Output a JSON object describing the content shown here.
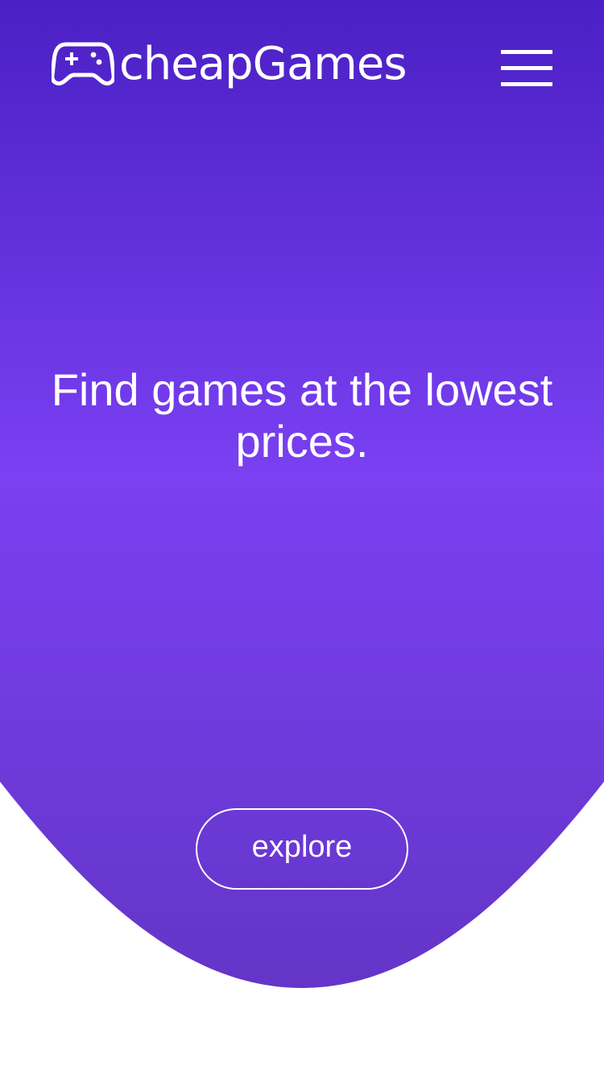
{
  "colors": {
    "gradient_top": "#4a20c4",
    "gradient_middle": "#7a40f2",
    "gradient_bottom": "#6435c7",
    "text": "#ffffff",
    "page_background": "#ffffff"
  },
  "header": {
    "logo_icon": "gamepad-icon",
    "logo_text": "cheapGames",
    "menu_icon": "hamburger-menu-icon"
  },
  "hero": {
    "headline": "Find games at the lowest prices.",
    "cta_label": "explore"
  }
}
